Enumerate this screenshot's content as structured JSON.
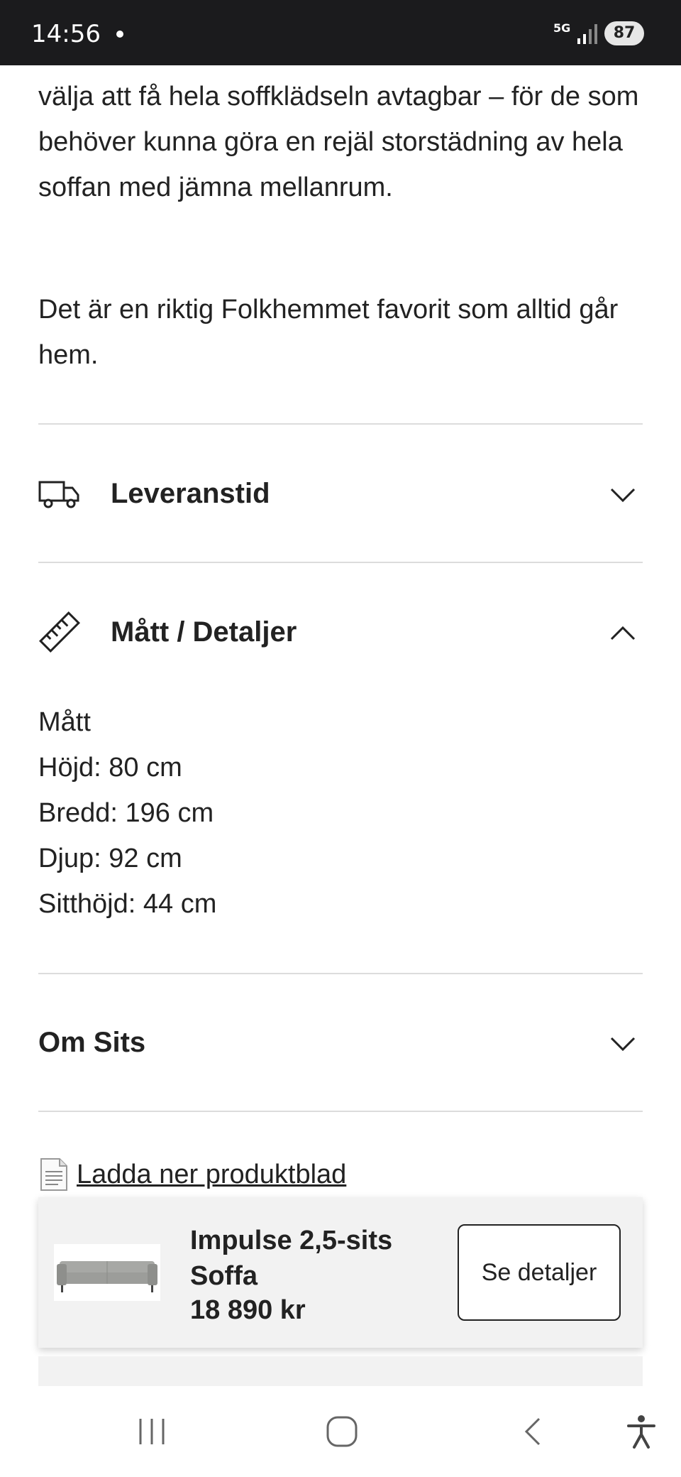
{
  "status_bar": {
    "time": "14:56",
    "network": "5G",
    "battery": "87"
  },
  "description": {
    "paragraph1": "välja att få hela soffklädseln avtagbar – för de som behöver kunna göra en rejäl storstädning av hela soffan med jämna mellanrum.",
    "paragraph2": "Det är en riktig Folkhemmet favorit som alltid går hem."
  },
  "accordions": [
    {
      "title": "Leveranstid",
      "icon": "truck-icon",
      "expanded": false
    },
    {
      "title": "Mått / Detaljer",
      "icon": "ruler-icon",
      "expanded": true
    },
    {
      "title": "Om Sits",
      "icon": "",
      "expanded": false
    }
  ],
  "details": {
    "heading": "Mått",
    "height": "Höjd: 80 cm",
    "width": "Bredd: 196 cm",
    "depth": "Djup: 92 cm",
    "seat_height": "Sitthöjd: 44 cm"
  },
  "download": {
    "label": "Ladda ner produktblad",
    "icon": "document-icon"
  },
  "sticky_product": {
    "name": "Impulse 2,5-sits Soffa",
    "price": "18 890 kr",
    "button_label": "Se detaljer"
  },
  "navbar": {
    "buttons": [
      "recent-apps",
      "home",
      "back",
      "accessibility"
    ]
  },
  "colors": {
    "text": "#222222",
    "divider": "#dcdcdc",
    "status_bar_bg": "#1b1b1d",
    "sticky_bg": "#f2f2f2"
  }
}
